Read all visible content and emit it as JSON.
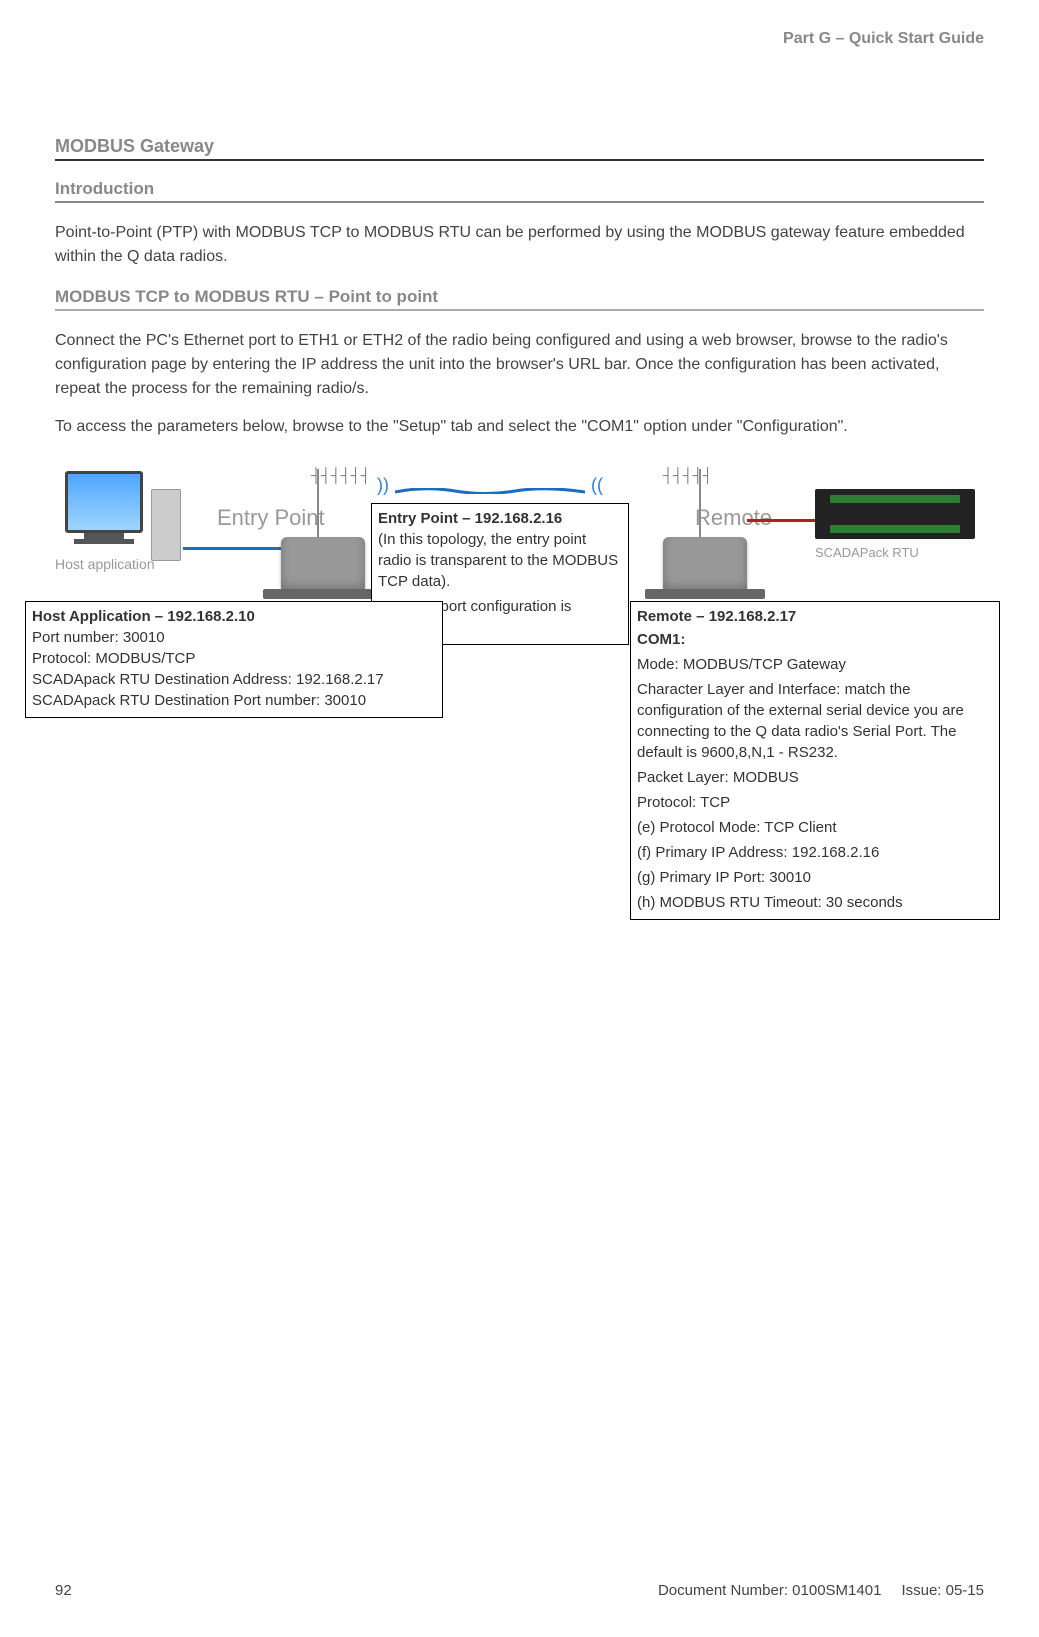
{
  "header": {
    "part": "Part G – Quick Start Guide"
  },
  "sections": {
    "title": "MODBUS Gateway",
    "intro_heading": "Introduction",
    "intro_body": "Point-to-Point (PTP) with MODBUS TCP to MODBUS RTU can be performed by using the MODBUS gateway feature embedded within the Q data radios.",
    "ptp_heading": "MODBUS TCP to MODBUS RTU – Point to point",
    "ptp_body1": "Connect the PC's Ethernet port to ETH1 or ETH2 of the radio being configured and using a web browser, browse to the radio's configuration page by entering the IP address the unit into the browser's URL bar.  Once the configuration has been activated, repeat the process for the remaining radio/s.",
    "ptp_body2": "To access the parameters below, browse to the \"Setup\" tab and select the \"COM1\" option under \"Configuration\"."
  },
  "diagram": {
    "host_label": "Host application",
    "entry_label": "Entry Point",
    "remote_label": "Remote",
    "scadapack_label": "SCADAPack RTU",
    "entry_box": {
      "title": "Entry Point – 192.168.2.16",
      "line1": "(In this topology, the entry point radio is transparent to the MODBUS TCP data).",
      "line2": "No COM port configuration is required."
    },
    "host_box": {
      "title": "Host Application – 192.168.2.10",
      "l1": "Port number: 30010",
      "l2": "Protocol: MODBUS/TCP",
      "l3": "SCADApack RTU Destination Address: 192.168.2.17",
      "l4": "SCADApack RTU Destination Port number: 30010"
    },
    "remote_box": {
      "title": "Remote – 192.168.2.17",
      "com_title": "COM1:",
      "l1": "Mode: MODBUS/TCP Gateway",
      "l2": "Character Layer and Interface: match the configuration of the external serial device you are connecting to the Q data radio's Serial Port. The default is 9600,8,N,1 - RS232.",
      "l3": "Packet Layer: MODBUS",
      "l4": "Protocol: TCP",
      "l5": "(e) Protocol Mode: TCP Client",
      "l6": "(f) Primary IP Address: 192.168.2.16",
      "l7": "(g) Primary IP Port: 30010",
      "l8": "(h) MODBUS RTU Timeout: 30 seconds"
    }
  },
  "footer": {
    "page": "92",
    "docnum": "Document Number: 0100SM1401",
    "issue": "Issue: 05-15"
  }
}
